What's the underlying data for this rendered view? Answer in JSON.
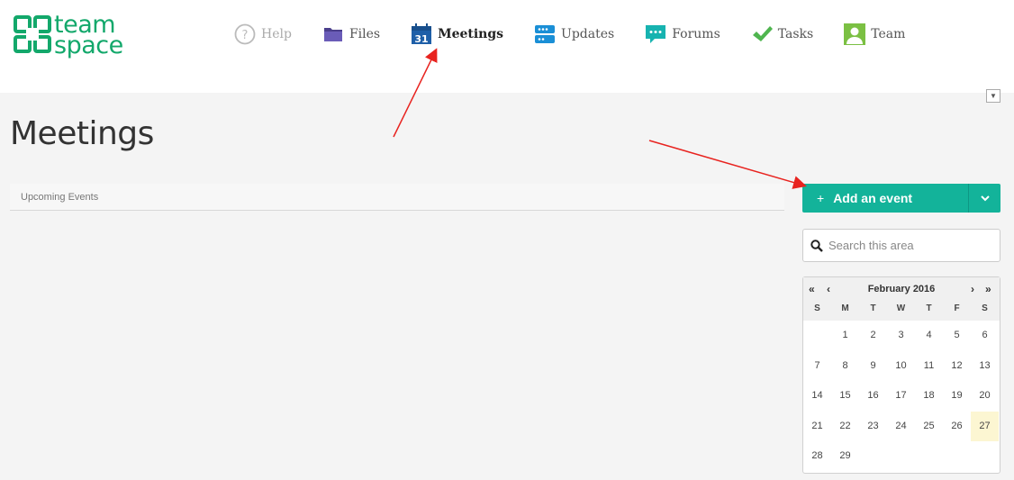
{
  "logo": {
    "line1": "team",
    "line2": "space"
  },
  "nav": [
    {
      "key": "help",
      "label": "Help"
    },
    {
      "key": "files",
      "label": "Files"
    },
    {
      "key": "meetings",
      "label": "Meetings"
    },
    {
      "key": "updates",
      "label": "Updates"
    },
    {
      "key": "forums",
      "label": "Forums"
    },
    {
      "key": "tasks",
      "label": "Tasks"
    },
    {
      "key": "team",
      "label": "Team"
    }
  ],
  "meetings_icon_day": "31",
  "page": {
    "title": "Meetings",
    "upcoming_label": "Upcoming Events"
  },
  "actions": {
    "add_label": "Add an event",
    "add_plus": "+"
  },
  "search": {
    "placeholder": "Search this area"
  },
  "calendar": {
    "month_label": "February 2016",
    "prev_year": "«",
    "prev_month": "‹",
    "next_month": "›",
    "next_year": "»",
    "weekdays": [
      "S",
      "M",
      "T",
      "W",
      "T",
      "F",
      "S"
    ],
    "weeks": [
      [
        "",
        "1",
        "2",
        "3",
        "4",
        "5",
        "6"
      ],
      [
        "7",
        "8",
        "9",
        "10",
        "11",
        "12",
        "13"
      ],
      [
        "14",
        "15",
        "16",
        "17",
        "18",
        "19",
        "20"
      ],
      [
        "21",
        "22",
        "23",
        "24",
        "25",
        "26",
        "27"
      ],
      [
        "28",
        "29",
        "",
        "",
        "",
        "",
        ""
      ]
    ],
    "highlighted_day": "27"
  },
  "colors": {
    "brand": "#13a86b",
    "accent": "#13b39a",
    "annotation": "#e8231f",
    "today": "#fcf6d2"
  }
}
